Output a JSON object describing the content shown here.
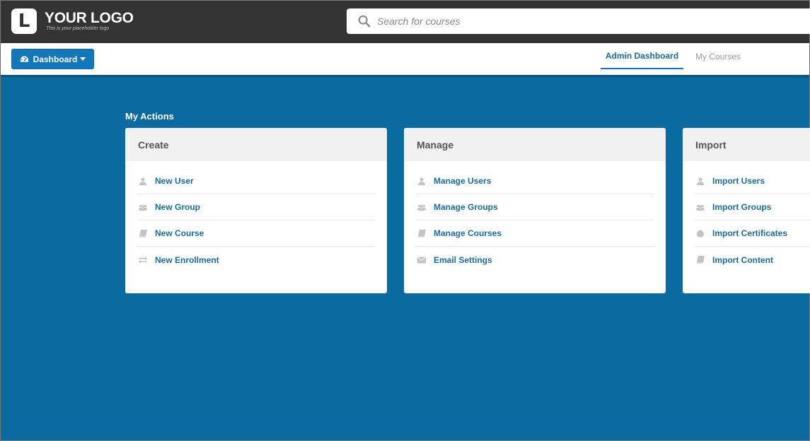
{
  "header": {
    "logo_letter": "L",
    "logo_title": "YOUR LOGO",
    "logo_tagline": "This is your placeholder logo",
    "search_placeholder": "Search for courses"
  },
  "navbar": {
    "dashboard_label": "Dashboard",
    "tabs": [
      {
        "label": "Admin Dashboard",
        "active": true
      },
      {
        "label": "My Courses",
        "active": false
      }
    ]
  },
  "main": {
    "section_title": "My Actions",
    "cards": [
      {
        "title": "Create",
        "items": [
          {
            "label": "New User",
            "icon": "user-icon"
          },
          {
            "label": "New Group",
            "icon": "group-icon"
          },
          {
            "label": "New Course",
            "icon": "book-icon"
          },
          {
            "label": "New Enrollment",
            "icon": "exchange-icon"
          }
        ]
      },
      {
        "title": "Manage",
        "items": [
          {
            "label": "Manage Users",
            "icon": "user-icon"
          },
          {
            "label": "Manage Groups",
            "icon": "group-icon"
          },
          {
            "label": "Manage Courses",
            "icon": "book-icon"
          },
          {
            "label": "Email Settings",
            "icon": "envelope-icon"
          }
        ]
      },
      {
        "title": "Import",
        "items": [
          {
            "label": "Import Users",
            "icon": "user-icon"
          },
          {
            "label": "Import Groups",
            "icon": "group-icon"
          },
          {
            "label": "Import Certificates",
            "icon": "certificate-icon"
          },
          {
            "label": "Import Content",
            "icon": "book-icon"
          }
        ]
      }
    ]
  },
  "colors": {
    "topbar": "#333333",
    "background": "#0b6aa0",
    "accent": "#1478b8",
    "link": "#1b6c9a",
    "icon": "#c4c4c4"
  }
}
